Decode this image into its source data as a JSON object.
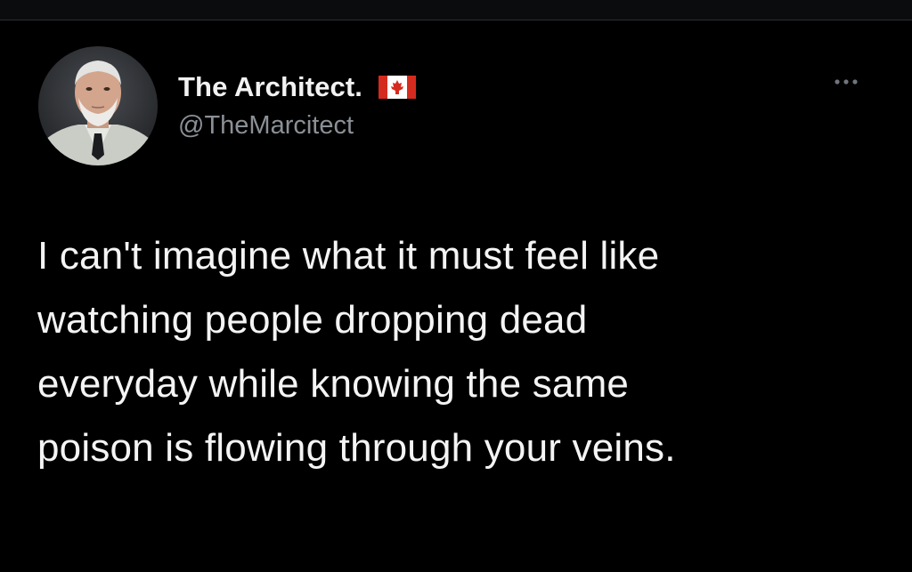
{
  "author": {
    "display_name": "The Architect.",
    "handle": "@TheMarcitect",
    "flag_icon": "canada-flag-icon",
    "avatar_icon": "avatar-icon"
  },
  "actions": {
    "more_icon": "more-options-icon"
  },
  "tweet": {
    "lines": [
      "I can't imagine what it must feel like",
      "watching people dropping dead",
      "everyday while knowing the same",
      "poison is flowing through your veins."
    ]
  },
  "colors": {
    "background": "#000000",
    "name": "#f2f2f2",
    "handle": "#8b9096",
    "body": "#f4f4f4",
    "flag_red": "#d52b1e"
  }
}
